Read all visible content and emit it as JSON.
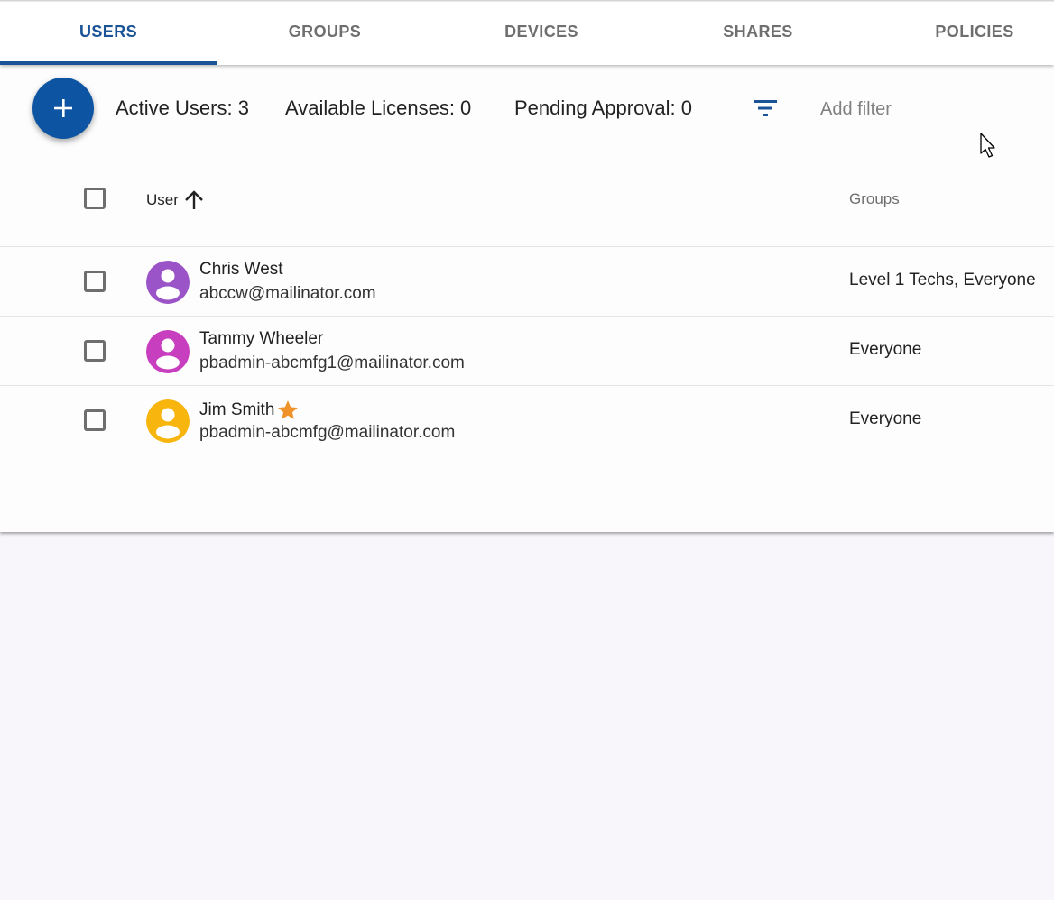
{
  "tabs": [
    {
      "label": "USERS",
      "active": true
    },
    {
      "label": "GROUPS",
      "active": false
    },
    {
      "label": "DEVICES",
      "active": false
    },
    {
      "label": "SHARES",
      "active": false
    },
    {
      "label": "POLICIES",
      "active": false
    }
  ],
  "toolbar": {
    "add_button_icon": "plus-icon",
    "active_users": "Active Users: 3",
    "available_licenses": "Available Licenses: 0",
    "pending_approval": "Pending Approval: 0",
    "filter_icon": "filter-icon",
    "add_filter": "Add filter"
  },
  "table": {
    "columns": {
      "user": "User",
      "groups": "Groups"
    },
    "sort": "ascending",
    "rows": [
      {
        "name": "Chris West",
        "email": "abccw@mailinator.com",
        "groups": "Level 1 Techs, Everyone",
        "avatar_color": "#9b54c7",
        "starred": false
      },
      {
        "name": "Tammy Wheeler",
        "email": "pbadmin-abcmfg1@mailinator.com",
        "groups": "Everyone",
        "avatar_color": "#c73fbf",
        "starred": false
      },
      {
        "name": "Jim Smith",
        "email": "pbadmin-abcmfg@mailinator.com",
        "groups": "Everyone",
        "avatar_color": "#f7b50e",
        "starred": true
      }
    ]
  },
  "colors": {
    "accent": "#1a5396",
    "fab": "#0d55a2",
    "star": "#f0922a"
  }
}
